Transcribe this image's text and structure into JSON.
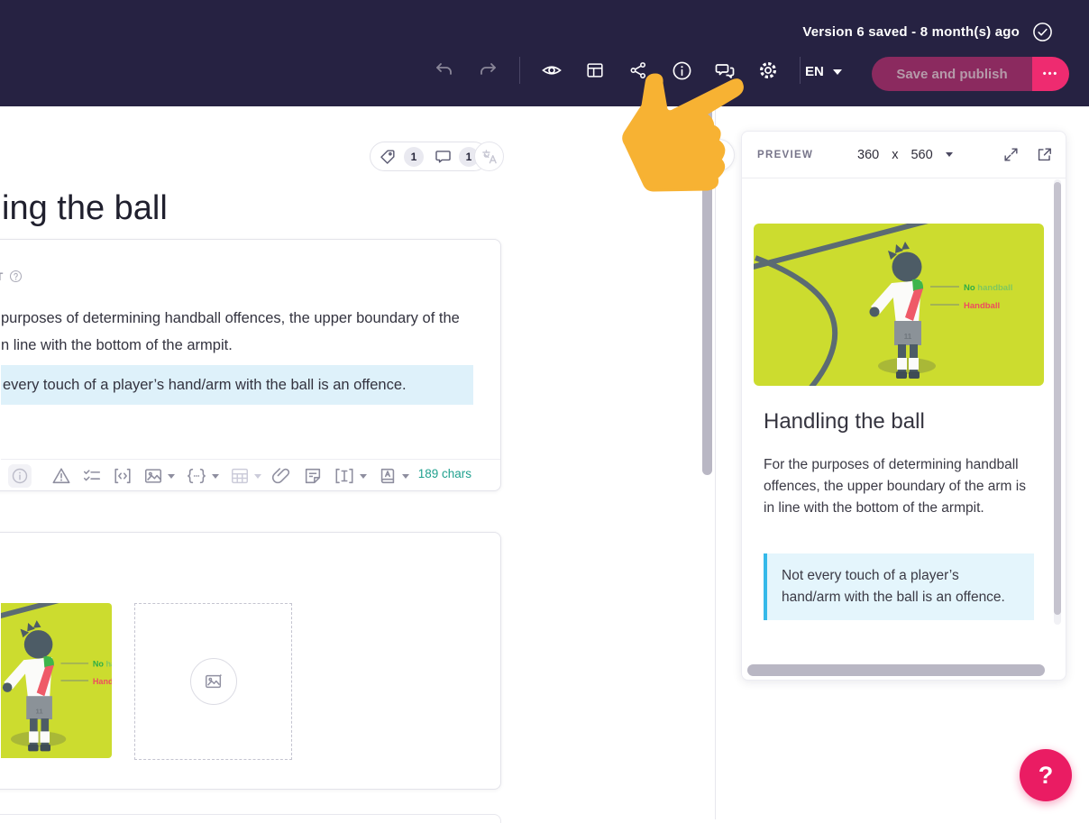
{
  "topbar": {
    "version_status": "Version 6 saved - 8 month(s) ago",
    "language": "EN",
    "save_label": "Save and publish",
    "more_label": "•••"
  },
  "editor": {
    "page_title": "ing the ball",
    "tag_badge": "1",
    "comment_badge": "1",
    "text_card": {
      "label_fragment": "T",
      "para_line1": "purposes of determining handball offences, the upper boundary of the",
      "para_line2": "n line with the bottom of the armpit.",
      "callout": "every touch of a player’s hand/arm with the ball is an offence.",
      "char_count": "189 chars"
    }
  },
  "preview": {
    "header_label": "PREVIEW",
    "size_width": "360",
    "size_sep": "x",
    "size_height": "560",
    "card_title": "Handling the ball",
    "card_body": "For the purposes of determining handball offences, the upper boundary of the arm is in line with the bottom of the armpit.",
    "card_callout": "Not every touch of a player’s hand/arm with the ball is an offence."
  },
  "illustration": {
    "no_handball_bold": "No",
    "no_handball_rest": " handball",
    "handball": "Handball",
    "jersey_number": "11"
  },
  "help_label": "?",
  "colors": {
    "topbar_bg": "#262242",
    "accent_pink": "#ee2b70",
    "save_muted": "#8b2a5f",
    "hand_yellow": "#f7b233",
    "field_green": "#ccdc2f",
    "callout_blue_bg": "#e4f5fc",
    "callout_blue_border": "#35b9e9",
    "char_count_teal": "#21a18f"
  }
}
